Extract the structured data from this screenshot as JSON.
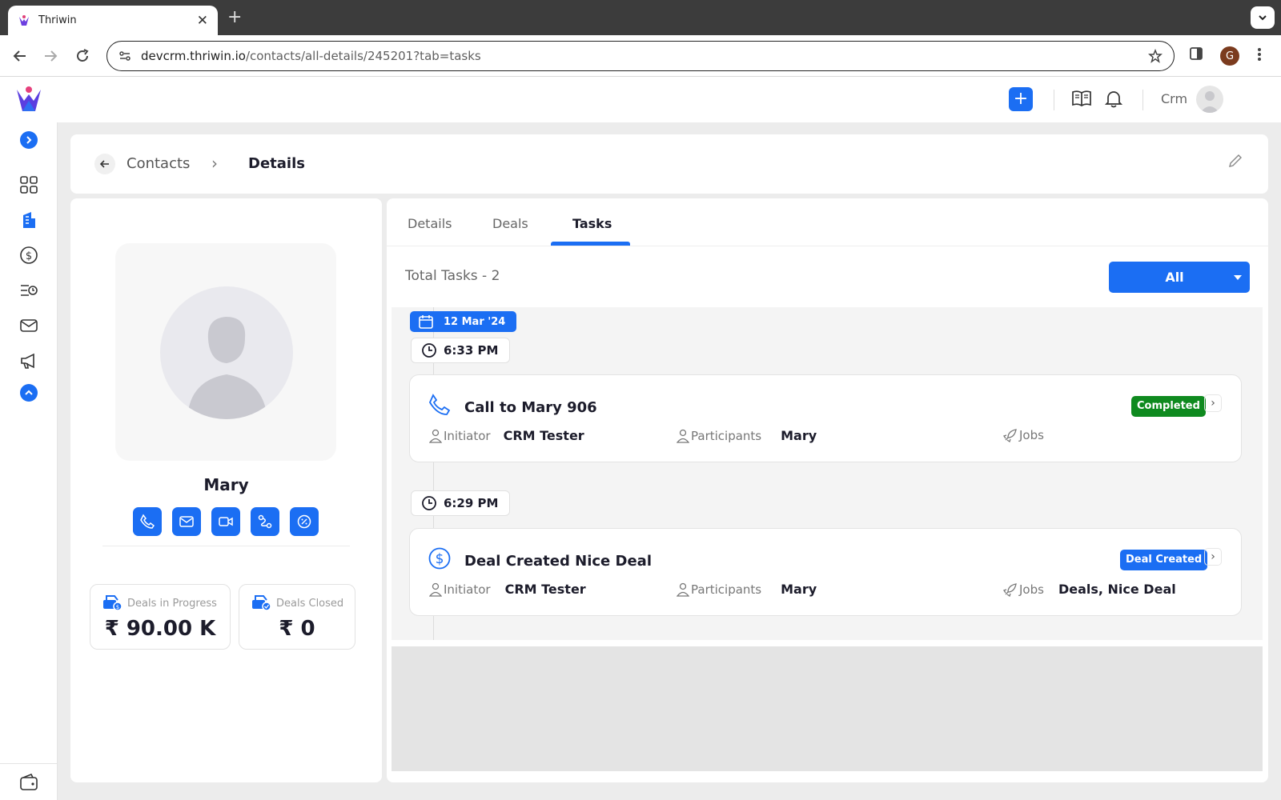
{
  "browser": {
    "tab_title": "Thriwin",
    "url_domain": "devcrm.thriwin.io",
    "url_path": "/contacts/all-details/245201?tab=tasks",
    "profile_initial": "G"
  },
  "header": {
    "user_name": "Crm"
  },
  "breadcrumb": {
    "parent": "Contacts",
    "current": "Details"
  },
  "contact": {
    "name": "Mary",
    "stats": [
      {
        "label": "Deals in Progress",
        "value": "₹ 90.00 K"
      },
      {
        "label": "Deals Closed",
        "value": "₹ 0"
      }
    ]
  },
  "tabs": [
    "Details",
    "Deals",
    "Tasks"
  ],
  "active_tab": "Tasks",
  "tasks_panel": {
    "total_label": "Total Tasks - 2",
    "filter_value": "All",
    "date": "12 Mar '24",
    "tasks": [
      {
        "time": "6:33 PM",
        "icon": "phone-icon",
        "title": "Call to Mary 906",
        "status": "Completed",
        "status_color": "#0f8a1f",
        "initiator_label": "Initiator",
        "initiator": "CRM Tester",
        "participants_label": "Participants",
        "participants": "Mary",
        "jobs_label": "Jobs",
        "jobs": ""
      },
      {
        "time": "6:29 PM",
        "icon": "dollar-circle-icon",
        "title": "Deal Created Nice Deal",
        "status": "Deal Created",
        "status_color": "#1b6ef3",
        "initiator_label": "Initiator",
        "initiator": "CRM Tester",
        "participants_label": "Participants",
        "participants": "Mary",
        "jobs_label": "Jobs",
        "jobs": "Deals, Nice Deal"
      }
    ]
  },
  "colors": {
    "accent": "#1b6ef3",
    "completed": "#0f8a1f"
  }
}
